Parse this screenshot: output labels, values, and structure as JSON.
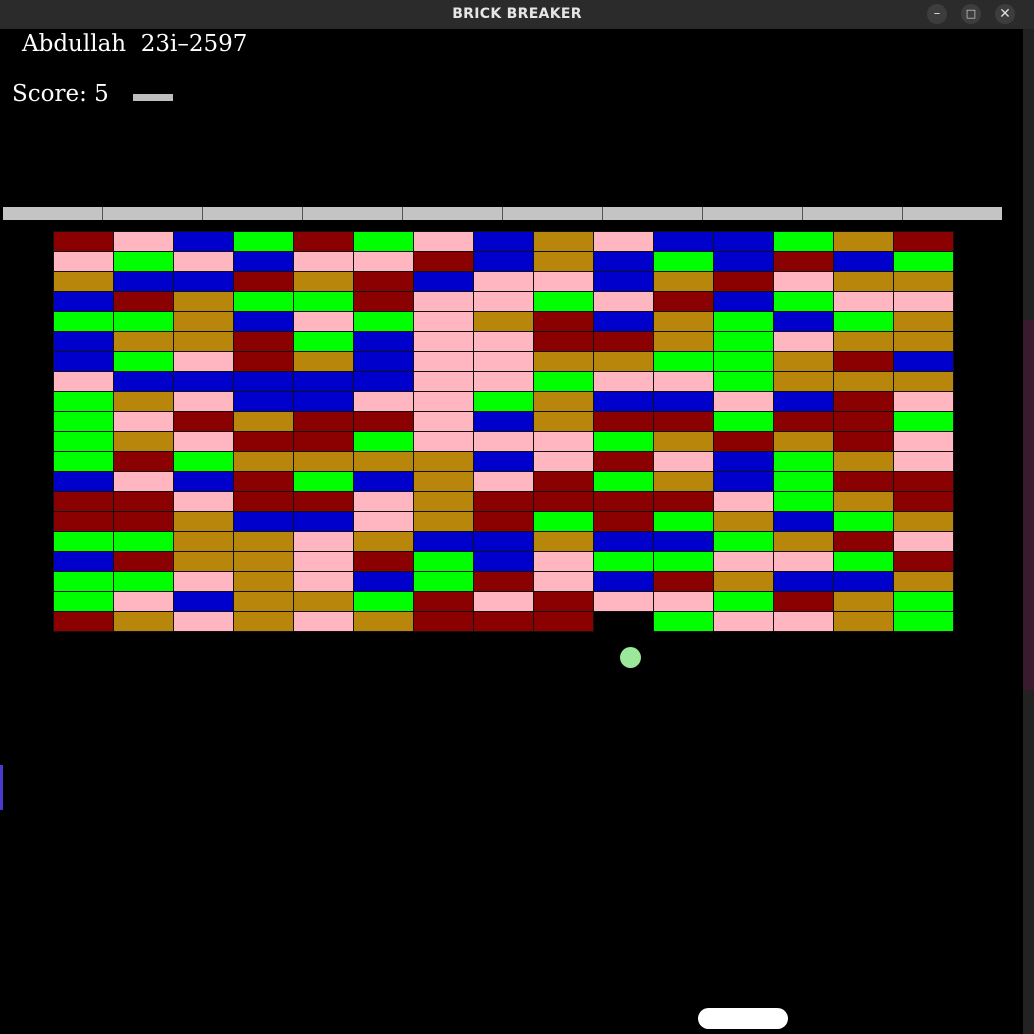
{
  "window": {
    "title": "BRICK BREAKER",
    "controls": {
      "minimize": "–",
      "maximize": "□",
      "close": "✕"
    }
  },
  "hud": {
    "player": "Abdullah  23i–2597",
    "score_text": "Score: 5"
  },
  "colors": {
    "R": "#8b0000",
    "P": "#ffb6c1",
    "B": "#0000cd",
    "G": "#00ff00",
    "O": "#b8860b",
    "background": "#000000",
    "ball": "#9be89b",
    "paddle": "#ffffff",
    "top_bar": "#c4c4c4"
  },
  "bricks": [
    "RPBGRGPBOPBBGOR",
    "PGPBPPRBOBGBRBG",
    "OBBRORBPPBORPOO",
    "BROGGRPPGPRBGPP",
    "GGOBPGPORBOGBGO",
    "BOORGBPPRROGPOO",
    "BGPROBPPOOGGORB",
    "PBBBBBPPGPPGOOO",
    "GOPBBPPGOBBPBRP",
    "GPRORRPBORRGRRG",
    "GOPRRGPPPGORORP",
    "GRGOOOOBPRPBGOP",
    "BPBRGBOPRGOBGRR",
    "RRPRRPORRRRPGOR",
    "RROBBPORGRGOBGO",
    "GGOOPOBBOBBGORP",
    "BROOPRGBPGGPPGR",
    "GGPOPBGRPBROBBO",
    "GPBOOGRPRPPGROG",
    "ROPOPORRR.GPPOG"
  ]
}
